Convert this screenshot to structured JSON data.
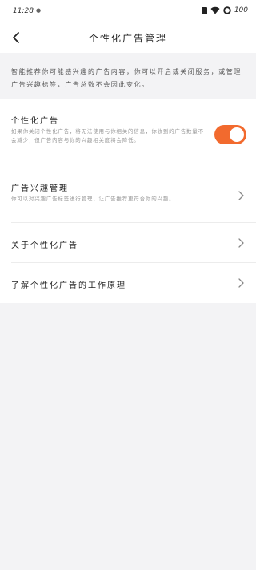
{
  "status_bar": {
    "time": "11:28",
    "notif_dot": "●",
    "battery": "100"
  },
  "nav": {
    "title": "个性化广告管理",
    "back_icon": "chevron-left-icon"
  },
  "intro": {
    "text": "智能推荐你可能感兴趣的广告内容，你可以开启或关闭服务，或管理广告兴趣标签，广告总数不会因此变化。"
  },
  "settings": {
    "personalized_ads": {
      "title": "个性化广告",
      "desc": "如果你关闭个性化广告，将无法使用与你相关的信息，你收到的广告数量不会减少，但广告内容与你的兴趣相关度将会降低。",
      "enabled": true,
      "toggle_color": "#f26a2e"
    },
    "interest_tags": {
      "title": "广告兴趣管理",
      "desc": "你可以对兴趣广告标签进行管理，让广告推荐更符合你的兴趣。"
    },
    "about": {
      "title": "关于个性化广告"
    },
    "how_it_works": {
      "title": "了解个性化广告的工作原理"
    }
  }
}
